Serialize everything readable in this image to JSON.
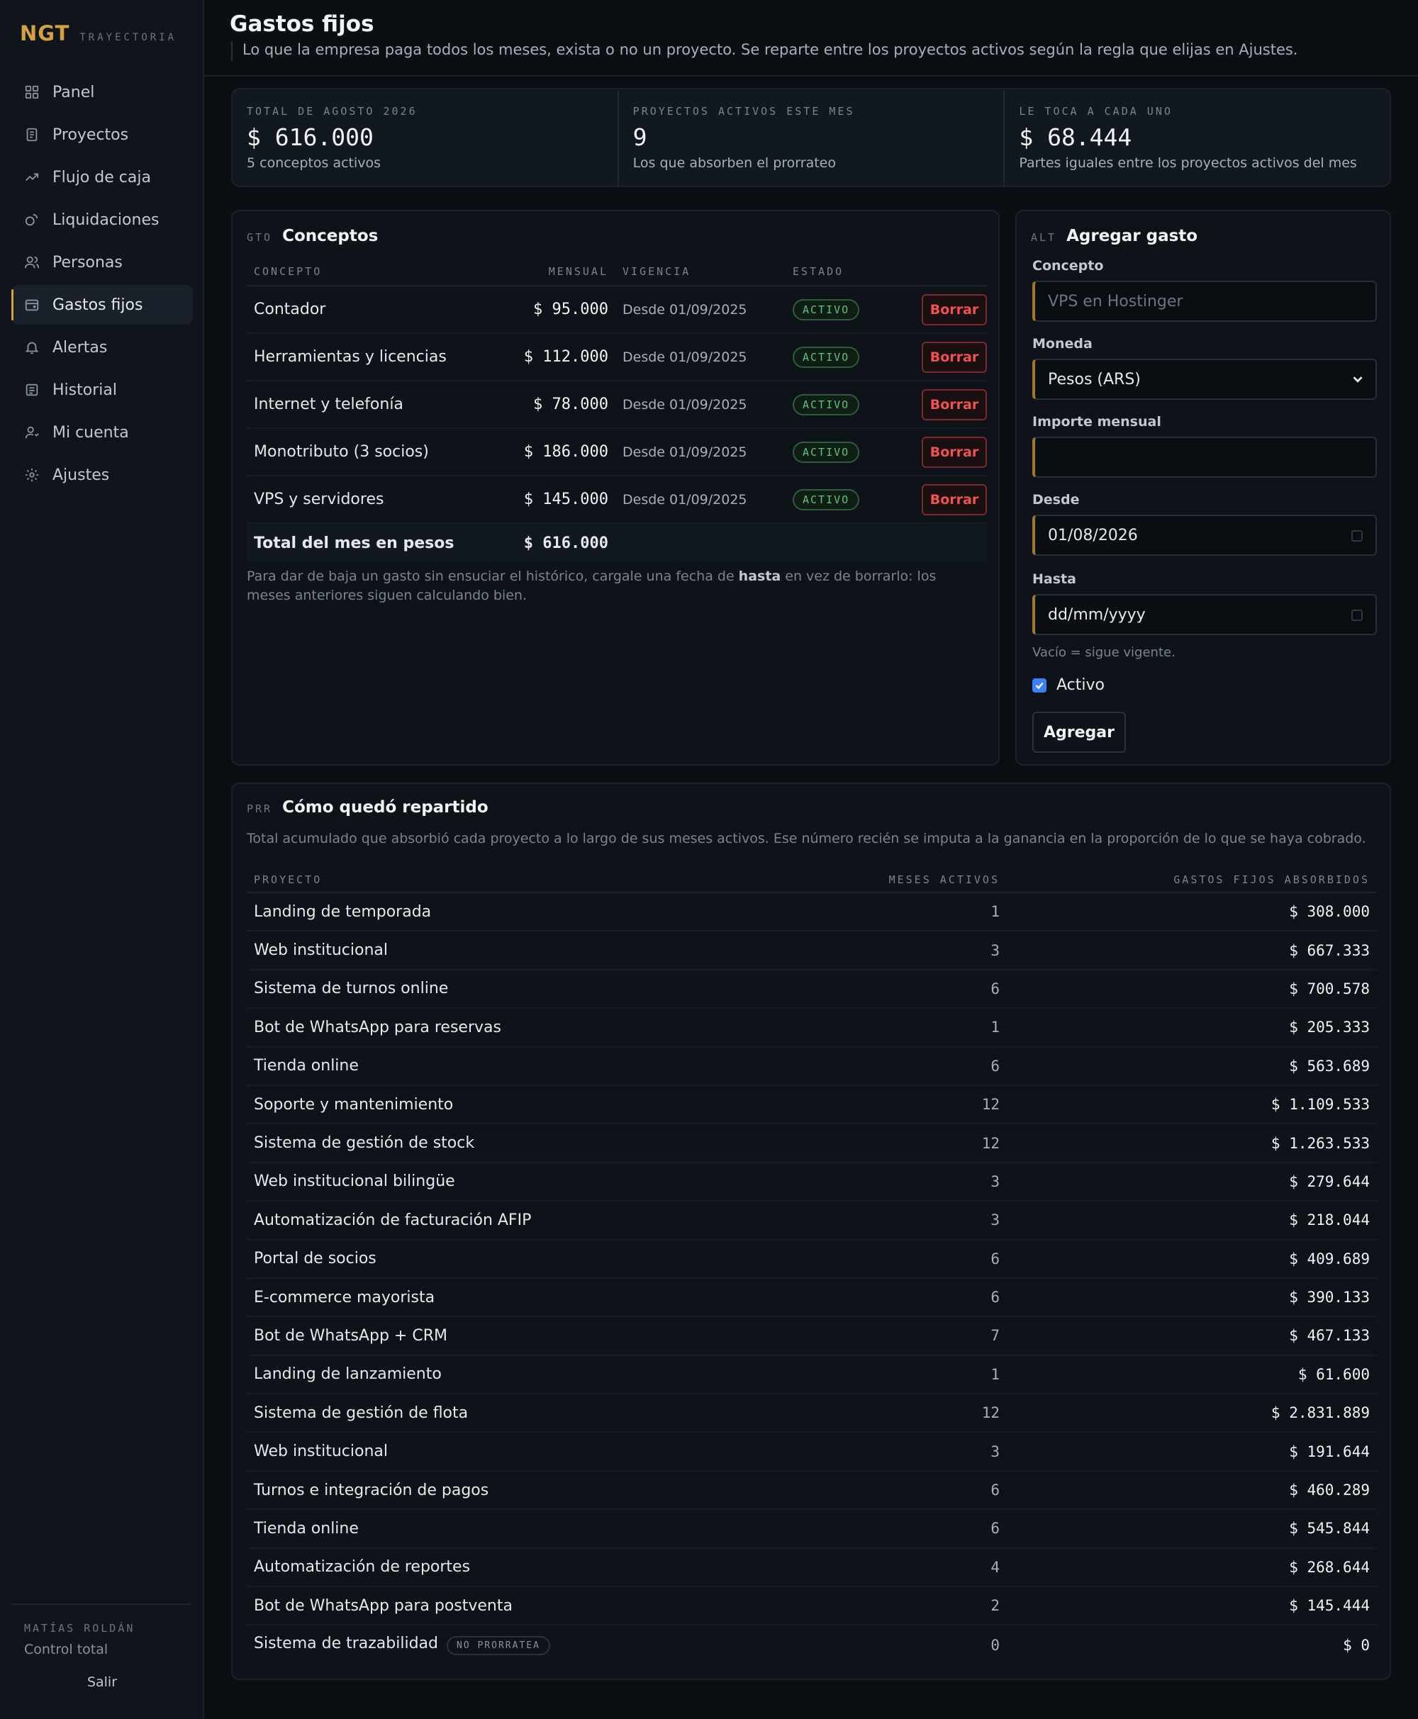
{
  "brand": {
    "logo": "NGT",
    "sub": "TRAYECTORIA"
  },
  "nav": [
    {
      "label": "Panel",
      "icon": "grid-icon"
    },
    {
      "label": "Proyectos",
      "icon": "document-icon"
    },
    {
      "label": "Flujo de caja",
      "icon": "trend-icon"
    },
    {
      "label": "Liquidaciones",
      "icon": "coins-icon"
    },
    {
      "label": "Personas",
      "icon": "users-icon"
    },
    {
      "label": "Gastos fijos",
      "icon": "wallet-icon",
      "active": true
    },
    {
      "label": "Alertas",
      "icon": "bell-icon"
    },
    {
      "label": "Historial",
      "icon": "history-icon"
    },
    {
      "label": "Mi cuenta",
      "icon": "user-icon"
    },
    {
      "label": "Ajustes",
      "icon": "gear-icon"
    }
  ],
  "user": {
    "name": "MATÍAS ROLDÁN",
    "role": "Control total",
    "logout": "Salir"
  },
  "header": {
    "title": "Gastos fijos",
    "description": "Lo que la empresa paga todos los meses, exista o no un proyecto. Se reparte entre los proyectos activos según la regla que elijas en Ajustes."
  },
  "stats": [
    {
      "label": "TOTAL DE AGOSTO 2026",
      "value": "$ 616.000",
      "sub": "5 conceptos activos"
    },
    {
      "label": "PROYECTOS ACTIVOS ESTE MES",
      "value": "9",
      "sub": "Los que absorben el prorrateo"
    },
    {
      "label": "LE TOCA A CADA UNO",
      "value": "$ 68.444",
      "sub": "Partes iguales entre los proyectos activos del mes"
    }
  ],
  "concepts": {
    "code": "GTO",
    "title": "Conceptos",
    "headers": {
      "concepto": "CONCEPTO",
      "mensual": "MENSUAL",
      "vigencia": "VIGENCIA",
      "estado": "ESTADO"
    },
    "rows": [
      {
        "concepto": "Contador",
        "mensual": "$ 95.000",
        "vigencia": "Desde 01/09/2025",
        "estado": "ACTIVO",
        "action": "Borrar"
      },
      {
        "concepto": "Herramientas y licencias",
        "mensual": "$ 112.000",
        "vigencia": "Desde 01/09/2025",
        "estado": "ACTIVO",
        "action": "Borrar"
      },
      {
        "concepto": "Internet y telefonía",
        "mensual": "$ 78.000",
        "vigencia": "Desde 01/09/2025",
        "estado": "ACTIVO",
        "action": "Borrar"
      },
      {
        "concepto": "Monotributo (3 socios)",
        "mensual": "$ 186.000",
        "vigencia": "Desde 01/09/2025",
        "estado": "ACTIVO",
        "action": "Borrar"
      },
      {
        "concepto": "VPS y servidores",
        "mensual": "$ 145.000",
        "vigencia": "Desde 01/09/2025",
        "estado": "ACTIVO",
        "action": "Borrar"
      }
    ],
    "total_label": "Total del mes en pesos",
    "total_value": "$ 616.000",
    "note_pre": "Para dar de baja un gasto sin ensuciar el histórico, cargale una fecha de ",
    "note_bold": "hasta",
    "note_post": " en vez de borrarlo: los meses anteriores siguen calculando bien."
  },
  "form": {
    "code": "ALT",
    "title": "Agregar gasto",
    "concepto_label": "Concepto",
    "concepto_placeholder": "VPS en Hostinger",
    "moneda_label": "Moneda",
    "moneda_value": "Pesos (ARS)",
    "importe_label": "Importe mensual",
    "importe_value": "",
    "desde_label": "Desde",
    "desde_value": "01/08/2026",
    "hasta_label": "Hasta",
    "hasta_placeholder": "dd/mm/yyyy",
    "hasta_hint": "Vacío = sigue vigente.",
    "activo_label": "Activo",
    "activo_checked": true,
    "submit": "Agregar"
  },
  "reparto": {
    "code": "PRR",
    "title": "Cómo quedó repartido",
    "description": "Total acumulado que absorbió cada proyecto a lo largo de sus meses activos. Ese número recién se imputa a la ganancia en la proporción de lo que se haya cobrado.",
    "headers": {
      "proyecto": "PROYECTO",
      "meses": "MESES ACTIVOS",
      "gastos": "GASTOS FIJOS ABSORBIDOS"
    },
    "rows": [
      {
        "proyecto": "Landing de temporada",
        "meses": "1",
        "gastos": "$ 308.000"
      },
      {
        "proyecto": "Web institucional",
        "meses": "3",
        "gastos": "$ 667.333"
      },
      {
        "proyecto": "Sistema de turnos online",
        "meses": "6",
        "gastos": "$ 700.578"
      },
      {
        "proyecto": "Bot de WhatsApp para reservas",
        "meses": "1",
        "gastos": "$ 205.333"
      },
      {
        "proyecto": "Tienda online",
        "meses": "6",
        "gastos": "$ 563.689"
      },
      {
        "proyecto": "Soporte y mantenimiento",
        "meses": "12",
        "gastos": "$ 1.109.533"
      },
      {
        "proyecto": "Sistema de gestión de stock",
        "meses": "12",
        "gastos": "$ 1.263.533"
      },
      {
        "proyecto": "Web institucional bilingüe",
        "meses": "3",
        "gastos": "$ 279.644"
      },
      {
        "proyecto": "Automatización de facturación AFIP",
        "meses": "3",
        "gastos": "$ 218.044"
      },
      {
        "proyecto": "Portal de socios",
        "meses": "6",
        "gastos": "$ 409.689"
      },
      {
        "proyecto": "E-commerce mayorista",
        "meses": "6",
        "gastos": "$ 390.133"
      },
      {
        "proyecto": "Bot de WhatsApp + CRM",
        "meses": "7",
        "gastos": "$ 467.133"
      },
      {
        "proyecto": "Landing de lanzamiento",
        "meses": "1",
        "gastos": "$ 61.600"
      },
      {
        "proyecto": "Sistema de gestión de flota",
        "meses": "12",
        "gastos": "$ 2.831.889"
      },
      {
        "proyecto": "Web institucional",
        "meses": "3",
        "gastos": "$ 191.644"
      },
      {
        "proyecto": "Turnos e integración de pagos",
        "meses": "6",
        "gastos": "$ 460.289"
      },
      {
        "proyecto": "Tienda online",
        "meses": "6",
        "gastos": "$ 545.844"
      },
      {
        "proyecto": "Automatización de reportes",
        "meses": "4",
        "gastos": "$ 268.644"
      },
      {
        "proyecto": "Bot de WhatsApp para postventa",
        "meses": "2",
        "gastos": "$ 145.444"
      },
      {
        "proyecto": "Sistema de trazabilidad",
        "badge": "NO PRORRATEA",
        "meses": "0",
        "gastos": "$ 0"
      }
    ]
  },
  "colors": {
    "accent": "#d4a13c",
    "success": "#5fc27a",
    "danger": "#ef5350",
    "checkbox": "#3b82f6"
  }
}
